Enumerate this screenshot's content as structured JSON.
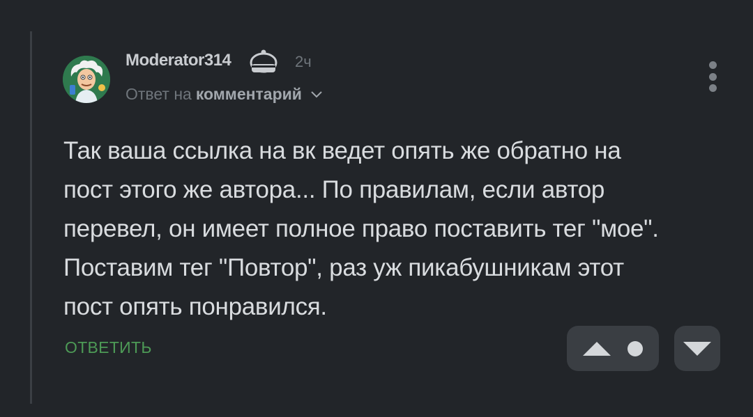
{
  "comment": {
    "username": "Moderator314",
    "time": "2ч",
    "reply_prefix": "Ответ на",
    "reply_link": "комментарий",
    "text_lines": [
      "Так ваша ссылка на вк ведет опять же обратно на",
      "пост этого же автора... По правилам, если автор",
      "перевел, он имеет полное право поставить тег \"мое\".",
      "Поставим тег \"Повтор\", раз уж пикабушникам этот",
      "пост опять понравился."
    ],
    "reply_button": "ОТВЕТИТЬ"
  },
  "icons": {
    "avatar": "scientist-avatar",
    "badge": "moderator-hat-icon",
    "menu": "more-vertical-icon",
    "upvote": "upvote-triangle-icon",
    "downvote": "downvote-triangle-icon"
  },
  "colors": {
    "background": "#222529",
    "accent_green": "#4d9a56",
    "vote_button_bg": "#3a3e43"
  }
}
